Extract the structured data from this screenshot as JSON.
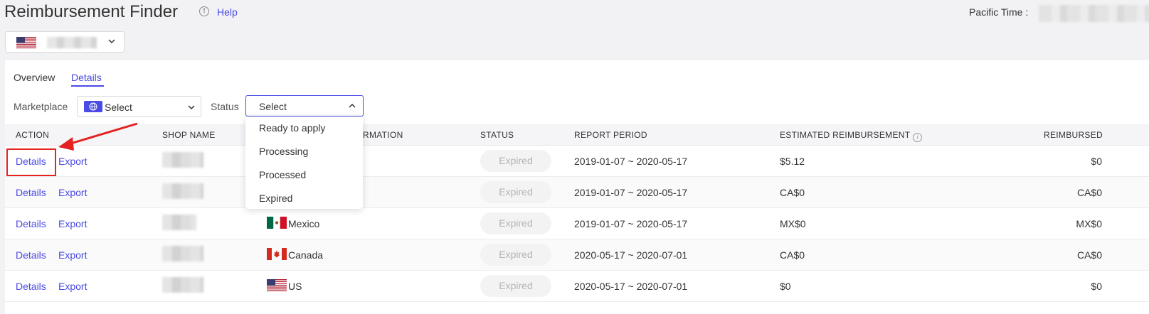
{
  "header": {
    "title": "Reimbursement Finder",
    "help_label": "Help",
    "pacific_time_label": "Pacific Time :"
  },
  "tabs": [
    {
      "label": "Overview",
      "active": false
    },
    {
      "label": "Details",
      "active": true
    }
  ],
  "filters": {
    "marketplace_label": "Marketplace",
    "marketplace_value": "Select",
    "status_label": "Status",
    "status_value": "Select",
    "status_options": [
      "Ready to apply",
      "Processing",
      "Processed",
      "Expired"
    ]
  },
  "table": {
    "columns": [
      "ACTION",
      "SHOP NAME",
      "RMATION",
      "STATUS",
      "REPORT PERIOD",
      "ESTIMATED REIMBURSEMENT",
      "REIMBURSED"
    ],
    "rows": [
      {
        "action1": "Details",
        "action2": "Export",
        "country": "",
        "status": "Expired",
        "period": "2019-01-07 ~ 2020-05-17",
        "estimated": "$5.12",
        "reimbursed": "$0"
      },
      {
        "action1": "Details",
        "action2": "Export",
        "country": "",
        "status": "Expired",
        "period": "2019-01-07 ~ 2020-05-17",
        "estimated": "CA$0",
        "reimbursed": "CA$0"
      },
      {
        "action1": "Details",
        "action2": "Export",
        "country": "Mexico",
        "status": "Expired",
        "period": "2019-01-07 ~ 2020-05-17",
        "estimated": "MX$0",
        "reimbursed": "MX$0"
      },
      {
        "action1": "Details",
        "action2": "Export",
        "country": "Canada",
        "status": "Expired",
        "period": "2020-05-17 ~ 2020-07-01",
        "estimated": "CA$0",
        "reimbursed": "CA$0"
      },
      {
        "action1": "Details",
        "action2": "Export",
        "country": "US",
        "status": "Expired",
        "period": "2020-05-17 ~ 2020-07-01",
        "estimated": "$0",
        "reimbursed": "$0"
      }
    ]
  },
  "colors": {
    "accent": "#4a4ae6",
    "annotation_red": "#e42222"
  }
}
